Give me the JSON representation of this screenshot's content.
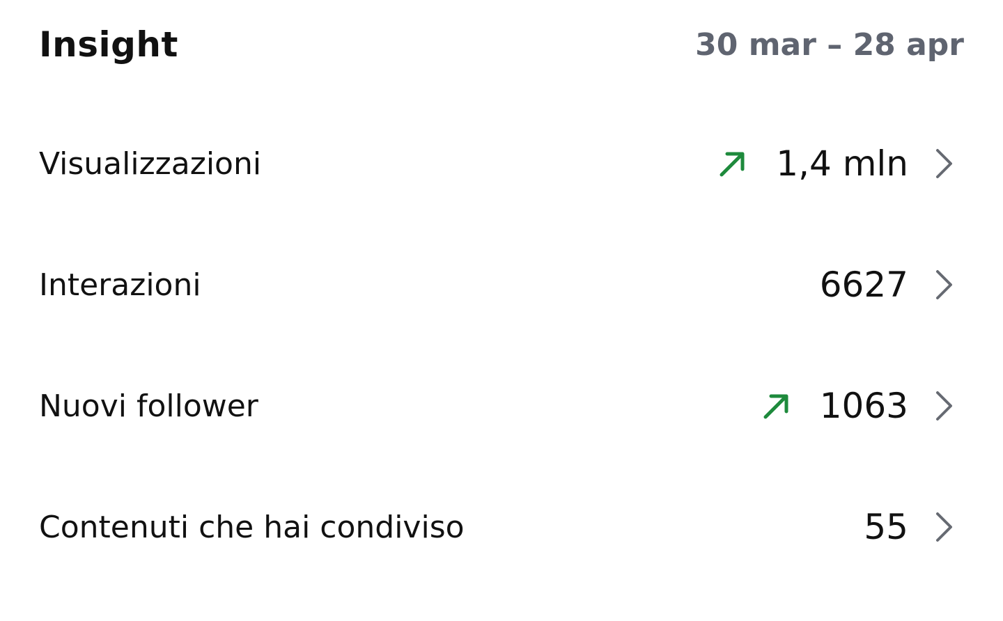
{
  "header": {
    "title": "Insight",
    "date_range": "30 mar – 28 apr"
  },
  "colors": {
    "trend_up": "#1e8a3c",
    "chevron": "#666a72",
    "date_text": "#5f6470"
  },
  "rows": [
    {
      "label": "Visualizzazioni",
      "value": "1,4 mln",
      "trend": "up",
      "trend_icon": "arrow-up-right-icon",
      "chevron_icon": "chevron-right-icon"
    },
    {
      "label": "Interazioni",
      "value": "6627",
      "trend": "none",
      "trend_icon": "",
      "chevron_icon": "chevron-right-icon"
    },
    {
      "label": "Nuovi follower",
      "value": "1063",
      "trend": "up",
      "trend_icon": "arrow-up-right-icon",
      "chevron_icon": "chevron-right-icon"
    },
    {
      "label": "Contenuti che hai condiviso",
      "value": "55",
      "trend": "none",
      "trend_icon": "",
      "chevron_icon": "chevron-right-icon"
    }
  ]
}
